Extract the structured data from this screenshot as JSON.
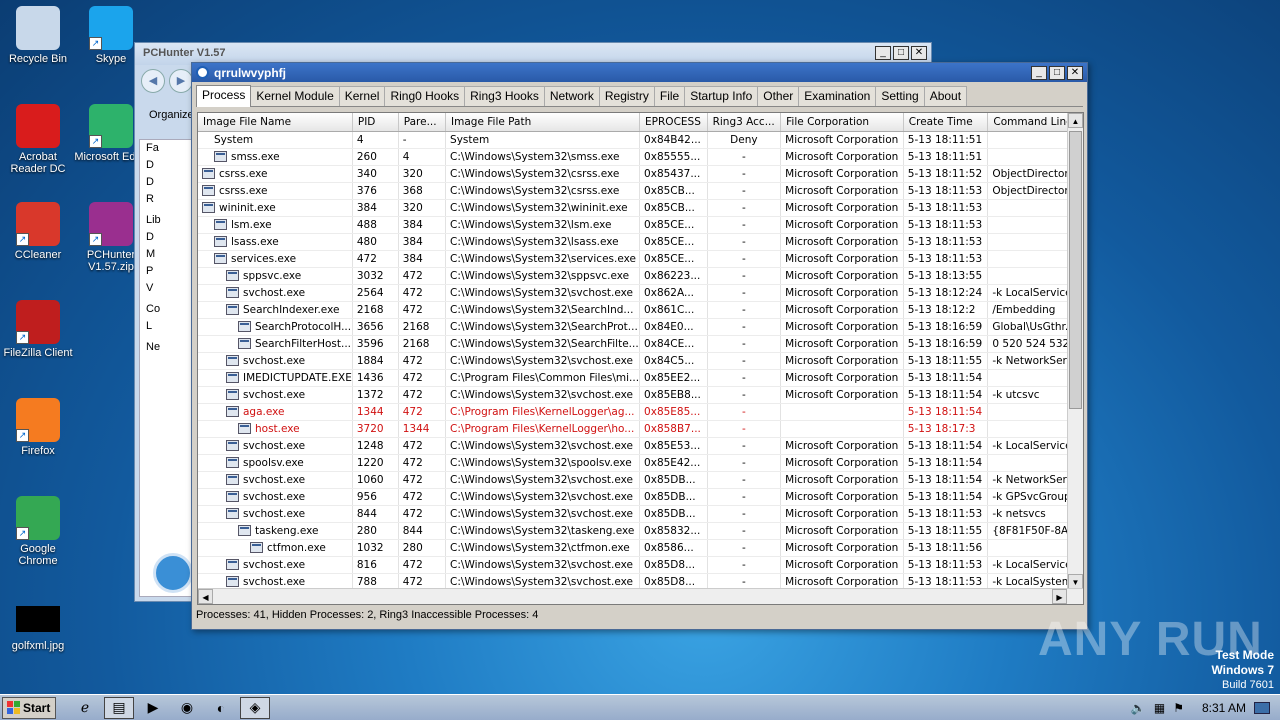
{
  "desktop": {
    "icons": [
      {
        "label": "Recycle Bin",
        "icon": "recycle-bin-icon",
        "color": "#c8d8ea"
      },
      {
        "label": "Skype",
        "icon": "skype-icon",
        "color": "#1ba4ec"
      },
      {
        "label": "Acrobat Reader DC",
        "icon": "acrobat-icon",
        "color": "#d91c1c"
      },
      {
        "label": "Microsoft Edge",
        "icon": "edge-icon",
        "color": "#2db26b"
      },
      {
        "label": "CCleaner",
        "icon": "ccleaner-icon",
        "color": "#d9382b"
      },
      {
        "label": "PCHunter V1.57.zip",
        "icon": "winrar-icon",
        "color": "#9a2f8f"
      },
      {
        "label": "FileZilla Client",
        "icon": "filezilla-icon",
        "color": "#bf1e1e"
      },
      {
        "label": "Firefox",
        "icon": "firefox-icon",
        "color": "#f57b20"
      },
      {
        "label": "Google Chrome",
        "icon": "chrome-icon",
        "color": "#34a853"
      },
      {
        "label": "golfxml.jpg",
        "icon": "image-file-icon",
        "color": "#000000"
      }
    ]
  },
  "back_window": {
    "title": "PCHunter V1.57",
    "toolbar_label": "Organize",
    "side_items": [
      "Fa",
      "D",
      "D",
      "R",
      "Lib",
      "D",
      "M",
      "P",
      "V",
      "Co",
      "L",
      "Ne"
    ]
  },
  "window": {
    "title": "qrrulwvyphfj",
    "tabs": [
      "Process",
      "Kernel Module",
      "Kernel",
      "Ring0 Hooks",
      "Ring3 Hooks",
      "Network",
      "Registry",
      "File",
      "Startup Info",
      "Other",
      "Examination",
      "Setting",
      "About"
    ],
    "active_tab": "Process",
    "columns": [
      "Image File Name",
      "PID",
      "Pare...",
      "Image File Path",
      "EPROCESS",
      "Ring3 Acc...",
      "File Corporation",
      "Create Time",
      "Command Line"
    ],
    "rows": [
      {
        "name": "System",
        "indent": 0,
        "icon": false,
        "pid": "4",
        "ppid": "-",
        "path": "System",
        "eprocess": "0x84B42...",
        "ring3": "Deny",
        "corp": "Microsoft Corporation",
        "time": "5-13 18:11:51",
        "cmd": "",
        "red": false
      },
      {
        "name": "smss.exe",
        "indent": 1,
        "icon": true,
        "pid": "260",
        "ppid": "4",
        "path": "C:\\Windows\\System32\\smss.exe",
        "eprocess": "0x85555...",
        "ring3": "-",
        "corp": "Microsoft Corporation",
        "time": "5-13 18:11:51",
        "cmd": "",
        "red": false
      },
      {
        "name": "csrss.exe",
        "indent": 0,
        "icon": true,
        "pid": "340",
        "ppid": "320",
        "path": "C:\\Windows\\System32\\csrss.exe",
        "eprocess": "0x85437...",
        "ring3": "-",
        "corp": "Microsoft Corporation",
        "time": "5-13 18:11:52",
        "cmd": "ObjectDirector...",
        "red": false
      },
      {
        "name": "csrss.exe",
        "indent": 0,
        "icon": true,
        "pid": "376",
        "ppid": "368",
        "path": "C:\\Windows\\System32\\csrss.exe",
        "eprocess": "0x85CB...",
        "ring3": "-",
        "corp": "Microsoft Corporation",
        "time": "5-13 18:11:53",
        "cmd": "ObjectDirector...",
        "red": false
      },
      {
        "name": "wininit.exe",
        "indent": 0,
        "icon": true,
        "pid": "384",
        "ppid": "320",
        "path": "C:\\Windows\\System32\\wininit.exe",
        "eprocess": "0x85CB...",
        "ring3": "-",
        "corp": "Microsoft Corporation",
        "time": "5-13 18:11:53",
        "cmd": "",
        "red": false
      },
      {
        "name": "lsm.exe",
        "indent": 1,
        "icon": true,
        "pid": "488",
        "ppid": "384",
        "path": "C:\\Windows\\System32\\lsm.exe",
        "eprocess": "0x85CE...",
        "ring3": "-",
        "corp": "Microsoft Corporation",
        "time": "5-13 18:11:53",
        "cmd": "",
        "red": false
      },
      {
        "name": "lsass.exe",
        "indent": 1,
        "icon": true,
        "pid": "480",
        "ppid": "384",
        "path": "C:\\Windows\\System32\\lsass.exe",
        "eprocess": "0x85CE...",
        "ring3": "-",
        "corp": "Microsoft Corporation",
        "time": "5-13 18:11:53",
        "cmd": "",
        "red": false
      },
      {
        "name": "services.exe",
        "indent": 1,
        "icon": true,
        "pid": "472",
        "ppid": "384",
        "path": "C:\\Windows\\System32\\services.exe",
        "eprocess": "0x85CE...",
        "ring3": "-",
        "corp": "Microsoft Corporation",
        "time": "5-13 18:11:53",
        "cmd": "",
        "red": false
      },
      {
        "name": "sppsvc.exe",
        "indent": 2,
        "icon": true,
        "pid": "3032",
        "ppid": "472",
        "path": "C:\\Windows\\System32\\sppsvc.exe",
        "eprocess": "0x86223...",
        "ring3": "-",
        "corp": "Microsoft Corporation",
        "time": "5-13 18:13:55",
        "cmd": "",
        "red": false
      },
      {
        "name": "svchost.exe",
        "indent": 2,
        "icon": true,
        "pid": "2564",
        "ppid": "472",
        "path": "C:\\Windows\\System32\\svchost.exe",
        "eprocess": "0x862A...",
        "ring3": "-",
        "corp": "Microsoft Corporation",
        "time": "5-13 18:12:24",
        "cmd": "-k LocalService...",
        "red": false
      },
      {
        "name": "SearchIndexer.exe",
        "indent": 2,
        "icon": true,
        "pid": "2168",
        "ppid": "472",
        "path": "C:\\Windows\\System32\\SearchInd...",
        "eprocess": "0x861C...",
        "ring3": "-",
        "corp": "Microsoft Corporation",
        "time": "5-13 18:12:2",
        "cmd": "/Embedding",
        "red": false
      },
      {
        "name": "SearchProtocolH...",
        "indent": 3,
        "icon": true,
        "pid": "3656",
        "ppid": "2168",
        "path": "C:\\Windows\\System32\\SearchProt...",
        "eprocess": "0x84E0...",
        "ring3": "-",
        "corp": "Microsoft Corporation",
        "time": "5-13 18:16:59",
        "cmd": "Global\\UsGthr...",
        "red": false
      },
      {
        "name": "SearchFilterHost...",
        "indent": 3,
        "icon": true,
        "pid": "3596",
        "ppid": "2168",
        "path": "C:\\Windows\\System32\\SearchFilte...",
        "eprocess": "0x84CE...",
        "ring3": "-",
        "corp": "Microsoft Corporation",
        "time": "5-13 18:16:59",
        "cmd": "0 520 524 532...",
        "red": false
      },
      {
        "name": "svchost.exe",
        "indent": 2,
        "icon": true,
        "pid": "1884",
        "ppid": "472",
        "path": "C:\\Windows\\System32\\svchost.exe",
        "eprocess": "0x84C5...",
        "ring3": "-",
        "corp": "Microsoft Corporation",
        "time": "5-13 18:11:55",
        "cmd": "-k NetworkSer...",
        "red": false
      },
      {
        "name": "IMEDICTUPDATE.EXE",
        "indent": 2,
        "icon": true,
        "pid": "1436",
        "ppid": "472",
        "path": "C:\\Program Files\\Common Files\\mi...",
        "eprocess": "0x85EE2...",
        "ring3": "-",
        "corp": "Microsoft Corporation",
        "time": "5-13 18:11:54",
        "cmd": "",
        "red": false
      },
      {
        "name": "svchost.exe",
        "indent": 2,
        "icon": true,
        "pid": "1372",
        "ppid": "472",
        "path": "C:\\Windows\\System32\\svchost.exe",
        "eprocess": "0x85EB8...",
        "ring3": "-",
        "corp": "Microsoft Corporation",
        "time": "5-13 18:11:54",
        "cmd": "-k utcsvc",
        "red": false
      },
      {
        "name": "aga.exe",
        "indent": 2,
        "icon": true,
        "pid": "1344",
        "ppid": "472",
        "path": "C:\\Program Files\\KernelLogger\\ag...",
        "eprocess": "0x85E85...",
        "ring3": "-",
        "corp": "",
        "time": "5-13 18:11:54",
        "cmd": "",
        "red": true
      },
      {
        "name": "host.exe",
        "indent": 3,
        "icon": true,
        "pid": "3720",
        "ppid": "1344",
        "path": "C:\\Program Files\\KernelLogger\\ho...",
        "eprocess": "0x858B7...",
        "ring3": "-",
        "corp": "",
        "time": "5-13 18:17:3",
        "cmd": "",
        "red": true
      },
      {
        "name": "svchost.exe",
        "indent": 2,
        "icon": true,
        "pid": "1248",
        "ppid": "472",
        "path": "C:\\Windows\\System32\\svchost.exe",
        "eprocess": "0x85E53...",
        "ring3": "-",
        "corp": "Microsoft Corporation",
        "time": "5-13 18:11:54",
        "cmd": "-k LocalService...",
        "red": false
      },
      {
        "name": "spoolsv.exe",
        "indent": 2,
        "icon": true,
        "pid": "1220",
        "ppid": "472",
        "path": "C:\\Windows\\System32\\spoolsv.exe",
        "eprocess": "0x85E42...",
        "ring3": "-",
        "corp": "Microsoft Corporation",
        "time": "5-13 18:11:54",
        "cmd": "",
        "red": false
      },
      {
        "name": "svchost.exe",
        "indent": 2,
        "icon": true,
        "pid": "1060",
        "ppid": "472",
        "path": "C:\\Windows\\System32\\svchost.exe",
        "eprocess": "0x85DB...",
        "ring3": "-",
        "corp": "Microsoft Corporation",
        "time": "5-13 18:11:54",
        "cmd": "-k NetworkSer...",
        "red": false
      },
      {
        "name": "svchost.exe",
        "indent": 2,
        "icon": true,
        "pid": "956",
        "ppid": "472",
        "path": "C:\\Windows\\System32\\svchost.exe",
        "eprocess": "0x85DB...",
        "ring3": "-",
        "corp": "Microsoft Corporation",
        "time": "5-13 18:11:54",
        "cmd": "-k GPSvcGroup",
        "red": false
      },
      {
        "name": "svchost.exe",
        "indent": 2,
        "icon": true,
        "pid": "844",
        "ppid": "472",
        "path": "C:\\Windows\\System32\\svchost.exe",
        "eprocess": "0x85DB...",
        "ring3": "-",
        "corp": "Microsoft Corporation",
        "time": "5-13 18:11:53",
        "cmd": "-k netsvcs",
        "red": false
      },
      {
        "name": "taskeng.exe",
        "indent": 3,
        "icon": true,
        "pid": "280",
        "ppid": "844",
        "path": "C:\\Windows\\System32\\taskeng.exe",
        "eprocess": "0x85832...",
        "ring3": "-",
        "corp": "Microsoft Corporation",
        "time": "5-13 18:11:55",
        "cmd": "{8F81F50F-8A...",
        "red": false
      },
      {
        "name": "ctfmon.exe",
        "indent": 4,
        "icon": true,
        "pid": "1032",
        "ppid": "280",
        "path": "C:\\Windows\\System32\\ctfmon.exe",
        "eprocess": "0x8586...",
        "ring3": "-",
        "corp": "Microsoft Corporation",
        "time": "5-13 18:11:56",
        "cmd": "",
        "red": false
      },
      {
        "name": "svchost.exe",
        "indent": 2,
        "icon": true,
        "pid": "816",
        "ppid": "472",
        "path": "C:\\Windows\\System32\\svchost.exe",
        "eprocess": "0x85D8...",
        "ring3": "-",
        "corp": "Microsoft Corporation",
        "time": "5-13 18:11:53",
        "cmd": "-k LocalService",
        "red": false
      },
      {
        "name": "svchost.exe",
        "indent": 2,
        "icon": true,
        "pid": "788",
        "ppid": "472",
        "path": "C:\\Windows\\System32\\svchost.exe",
        "eprocess": "0x85D8...",
        "ring3": "-",
        "corp": "Microsoft Corporation",
        "time": "5-13 18:11:53",
        "cmd": "-k LocalSystem...",
        "red": false
      }
    ],
    "status": "Processes: 41, Hidden Processes: 2, Ring3 Inaccessible Processes: 4"
  },
  "taskbar": {
    "start_label": "Start",
    "items": [
      "ie-icon",
      "explorer-icon",
      "media-player-icon",
      "chrome-icon",
      "edge-icon",
      "pchunter-icon"
    ],
    "clock": "8:31 AM"
  },
  "watermark": "ANY RUN",
  "test_mode": {
    "line1": "Test Mode",
    "line2": "Windows 7",
    "line3": "Build 7601"
  }
}
